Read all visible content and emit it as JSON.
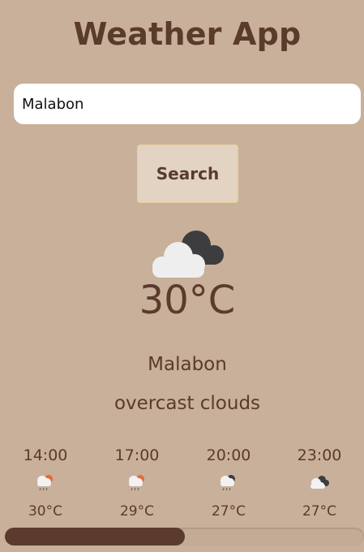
{
  "app": {
    "title": "Weather App"
  },
  "search": {
    "value": "Malabon",
    "placeholder": "",
    "button_label": "Search"
  },
  "current": {
    "icon": "overcast-clouds-icon",
    "temperature": "30°C",
    "city": "Malabon",
    "description": "overcast clouds"
  },
  "hourly": [
    {
      "time": "14:00",
      "icon": "rain-cloud-sun-icon",
      "temp": "30°C"
    },
    {
      "time": "17:00",
      "icon": "rain-cloud-sun-icon",
      "temp": "29°C"
    },
    {
      "time": "20:00",
      "icon": "rain-cloud-dark-icon",
      "temp": "27°C"
    },
    {
      "time": "23:00",
      "icon": "overcast-clouds-icon",
      "temp": "27°C"
    }
  ],
  "scroll": {
    "position": 0.5
  },
  "colors": {
    "background": "#c9b09a",
    "text": "#5a3b2c",
    "button_bg": "#e2d3c2",
    "button_border": "#e6d09a",
    "scroll_thumb": "#5a3b2c"
  }
}
